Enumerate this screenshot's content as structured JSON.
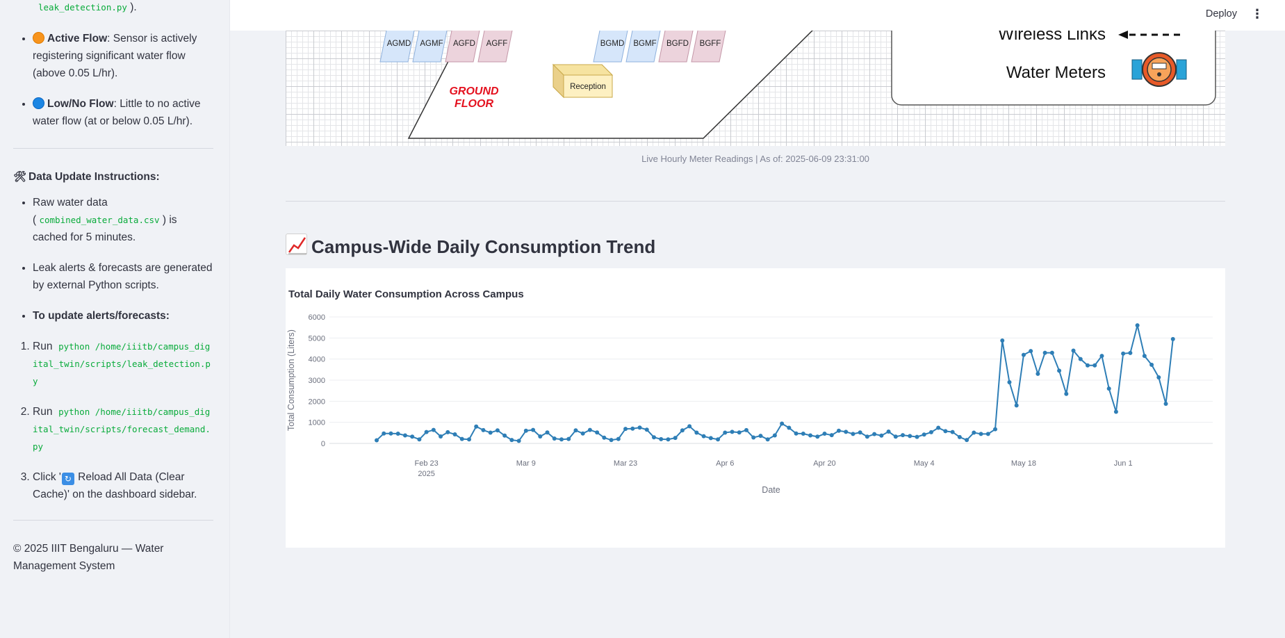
{
  "sidebar": {
    "top_code": "leak_detection.py",
    "top_suffix": " ).",
    "legend": [
      {
        "title": "Active Flow",
        "desc": ": Sensor is actively registering significant water flow (above 0.05 L/hr).",
        "color": "#f7941d"
      },
      {
        "title": "Low/No Flow",
        "desc": ": Little to no active water flow (at or below 0.05 L/hr).",
        "color": "#1c86e3"
      }
    ],
    "update_heading": "Data Update Instructions:",
    "update_icon": "hammer-wrench-icon",
    "bullet1_prefix": "Raw water data",
    "bullet1_open": "( ",
    "bullet1_code": "combined_water_data.csv",
    "bullet1_suffix": " ) is cached for 5 minutes.",
    "bullet2": "Leak alerts & forecasts are generated by external Python scripts.",
    "bullet3": "To update alerts/forecasts:",
    "steps": [
      {
        "prefix": "Run",
        "code": "python /home/iiitb/campus_digital_twin/scripts/leak_detection.py"
      },
      {
        "prefix": "Run",
        "code": "python /home/iiitb/campus_digital_twin/scripts/forecast_demand.py"
      }
    ],
    "step3_prefix": "Click '",
    "step3_label": " Reload All Data (Clear Cache)'",
    "step3_suffix": " on the dashboard sidebar.",
    "footer": "© 2025 IIIT Bengaluru — Water Management System"
  },
  "topbar": {
    "deploy_label": "Deploy",
    "menu_glyph": "⋮"
  },
  "diagram": {
    "meters_left": [
      "AGMD",
      "AGMF",
      "AGFD",
      "AGFF"
    ],
    "meters_right": [
      "BGMD",
      "BGMF",
      "BGFD",
      "BGFF"
    ],
    "reception_label": "Reception",
    "floor_label_1": "GROUND",
    "floor_label_2": "FLOOR",
    "legend_wireless": "Wireless Links",
    "legend_meters": "Water Meters"
  },
  "caption": "Live Hourly Meter Readings | As of: 2025-06-09 23:31:00",
  "section": {
    "title": "Campus-Wide Daily Consumption Trend",
    "icon": "chart-increasing-icon"
  },
  "chart_data": {
    "type": "line",
    "title": "Total Daily Water Consumption Across Campus",
    "xlabel": "Date",
    "ylabel": "Total Consumption (Liters)",
    "ylim": [
      0,
      6000
    ],
    "yticks": [
      0,
      1000,
      2000,
      3000,
      4000,
      5000,
      6000
    ],
    "xtick_labels": [
      "Feb 23",
      "Mar 9",
      "Mar 23",
      "Apr 6",
      "Apr 20",
      "May 4",
      "May 18",
      "Jun 1"
    ],
    "xtick_dates": [
      "2025-02-23",
      "2025-03-09",
      "2025-03-23",
      "2025-04-06",
      "2025-04-20",
      "2025-05-04",
      "2025-05-18",
      "2025-06-01"
    ],
    "year_label": "2025",
    "grid": true,
    "line_color": "#2e7eb6",
    "start_date": "2025-02-16",
    "values": [
      150,
      470,
      470,
      460,
      380,
      320,
      190,
      540,
      640,
      330,
      530,
      430,
      210,
      190,
      800,
      630,
      510,
      620,
      370,
      160,
      120,
      600,
      640,
      330,
      520,
      230,
      190,
      210,
      620,
      470,
      640,
      520,
      270,
      160,
      210,
      690,
      700,
      750,
      650,
      290,
      200,
      190,
      260,
      620,
      810,
      510,
      340,
      250,
      190,
      510,
      550,
      520,
      630,
      280,
      360,
      190,
      380,
      940,
      740,
      470,
      460,
      380,
      320,
      460,
      390,
      600,
      550,
      450,
      520,
      320,
      440,
      370,
      560,
      320,
      390,
      350,
      310,
      420,
      530,
      740,
      580,
      540,
      300,
      160,
      510,
      450,
      450,
      670,
      4880,
      2900,
      1800,
      4200,
      4380,
      3300,
      4300,
      4300,
      3450,
      2350,
      4400,
      4000,
      3700,
      3700,
      4150,
      2600,
      1500,
      4260,
      4290,
      5600,
      4150,
      3730,
      3130,
      1880,
      4950
    ]
  }
}
